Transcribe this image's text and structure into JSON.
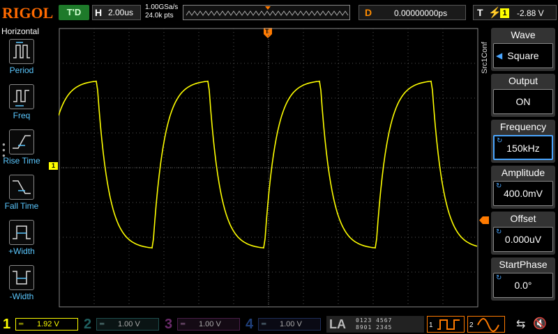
{
  "topbar": {
    "logo": "RIGOL",
    "run_status": "T'D",
    "horizontal": {
      "label": "H",
      "value": "2.00us"
    },
    "sample_rate": "1.00GSa/s",
    "memory_depth": "24.0k pts",
    "delay": {
      "label": "D",
      "value": "0.00000000ps"
    },
    "trigger": {
      "label": "T",
      "channel": "1",
      "level": "-2.88 V"
    }
  },
  "left_menu": {
    "title": "Horizontal",
    "items": [
      {
        "label": "Period"
      },
      {
        "label": "Freq"
      },
      {
        "label": "Rise Time"
      },
      {
        "label": "Fall Time"
      },
      {
        "label": "+Width"
      },
      {
        "label": "-Width"
      }
    ]
  },
  "source_tab": "Src1Conf",
  "right_menu": {
    "items": [
      {
        "title": "Wave",
        "value": "Square"
      },
      {
        "title": "Output",
        "value": "ON"
      },
      {
        "title": "Frequency",
        "value": "150kHz"
      },
      {
        "title": "Amplitude",
        "value": "400.0mV"
      },
      {
        "title": "Offset",
        "value": "0.000uV"
      },
      {
        "title": "StartPhase",
        "value": "0.0°"
      }
    ]
  },
  "markers": {
    "trigger_top": "T",
    "ch1": "1"
  },
  "channels": [
    {
      "num": "1",
      "coupling": "═",
      "scale": "1.92 V",
      "color": "#ffff00"
    },
    {
      "num": "2",
      "coupling": "═",
      "scale": "1.00 V",
      "color": "#00c8c8"
    },
    {
      "num": "3",
      "coupling": "═",
      "scale": "1.00 V",
      "color": "#ff40ff"
    },
    {
      "num": "4",
      "coupling": "═",
      "scale": "1.00 V",
      "color": "#2f7fff"
    }
  ],
  "la": {
    "label": "LA",
    "row1": "0123 4567",
    "row2": "8901 2345"
  },
  "generators": [
    {
      "num": "1"
    },
    {
      "num": "2"
    }
  ],
  "colors": {
    "accent": "#ff7a00",
    "ch1": "#ffff00",
    "menu_label": "#5bc8ff",
    "selection": "#4aa6ff"
  },
  "icons": [
    "usb-icon",
    "speaker-muted-icon"
  ]
}
